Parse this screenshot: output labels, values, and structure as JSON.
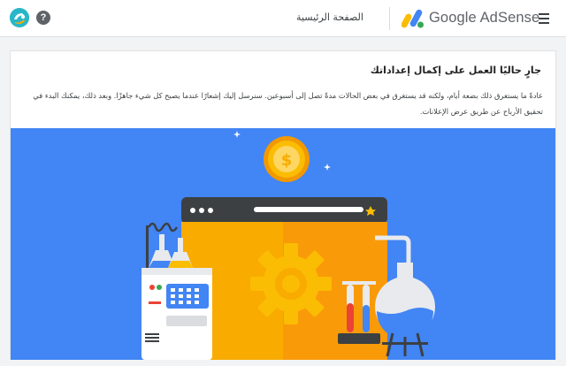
{
  "header": {
    "brand": "Google AdSense",
    "home_link": "الصفحة الرئيسية",
    "help_glyph": "?",
    "menu_icon": "hamburger-menu-icon",
    "logo_icon": "adsense-logo-icon",
    "avatar_icon": "account-avatar-icon"
  },
  "setup_card": {
    "title": "جارٍ حاليًا العمل على إكمال إعداداتك",
    "description": "عادةً ما يستغرق ذلك بضعة أيام، ولكنه قد يستغرق في بعض الحالات مدةً تصل إلى أسبوعين. سنرسل إليك إشعارًا عندما يصبح كل شيء جاهزًا. وبعد ذلك، يمكنك البدء في تحقيق الأرباح عن طريق عرض الإعلانات."
  },
  "illustration": {
    "background": "#4285f4",
    "yellow": "#fbbc04",
    "orange": "#f9a825",
    "dark": "#3c4043",
    "coin_symbol": "$"
  }
}
